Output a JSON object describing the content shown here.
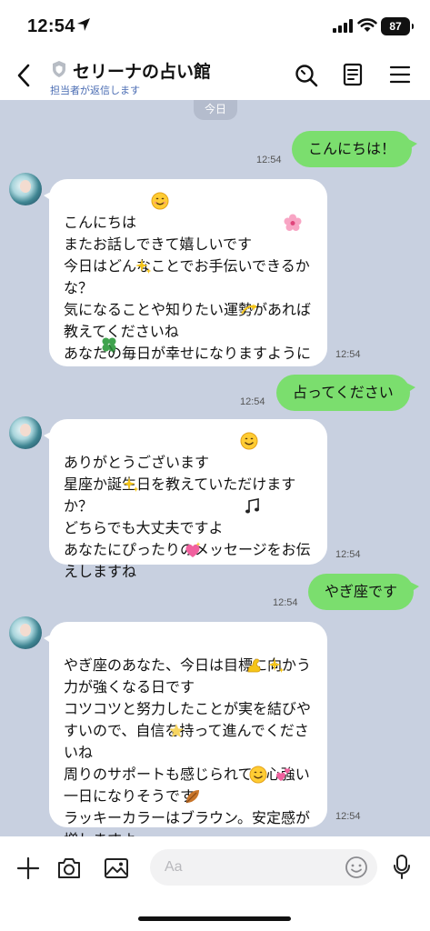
{
  "status_bar": {
    "time": "12:54",
    "battery": "87"
  },
  "header": {
    "title": "セリーナの占い館",
    "subtitle": "担当者が返信します"
  },
  "chat": {
    "date_label": "今日",
    "messages": [
      {
        "from": "me",
        "text": "こんにちは！",
        "time": "12:54"
      },
      {
        "from": "bot",
        "text": "こんにちは\nまたお話しできて嬉しいです\n今日はどんなことでお手伝いできるかな？\n気になることや知りたい運勢があれば教えてくださいね\nあなたの毎日が幸せになりますように",
        "time": "12:54"
      },
      {
        "from": "me",
        "text": "占ってください",
        "time": "12:54"
      },
      {
        "from": "bot",
        "text": "ありがとうございます\n星座か誕生日を教えていただけますか？\nどちらでも大丈夫ですよ\nあなたにぴったりのメッセージをお伝えしますね",
        "time": "12:54"
      },
      {
        "from": "me",
        "text": "やぎ座です",
        "time": "12:54"
      },
      {
        "from": "bot",
        "text": "やぎ座のあなた、今日は目標に向かう力が強くなる日です\nコツコツと努力したことが実を結びやすいので、自信を持って進んでくださいね\n周りのサポートも感じられて、心強い一日になりそうです\nラッキーカラーはブラウン。安定感が増しますよ",
        "time": "12:54"
      }
    ]
  },
  "input": {
    "placeholder": "Aa"
  },
  "colors": {
    "chat_background": "#c8d0e0",
    "outgoing_bubble": "#7bde6e",
    "incoming_bubble": "#ffffff",
    "subtitle": "#4a6cb3"
  },
  "icons": [
    "location-arrow-icon",
    "signal-icon",
    "wifi-icon",
    "battery-icon",
    "back-icon",
    "shield-icon",
    "search-icon",
    "notes-icon",
    "menu-icon",
    "plus-icon",
    "camera-icon",
    "image-icon",
    "emoji-icon",
    "mic-icon"
  ]
}
